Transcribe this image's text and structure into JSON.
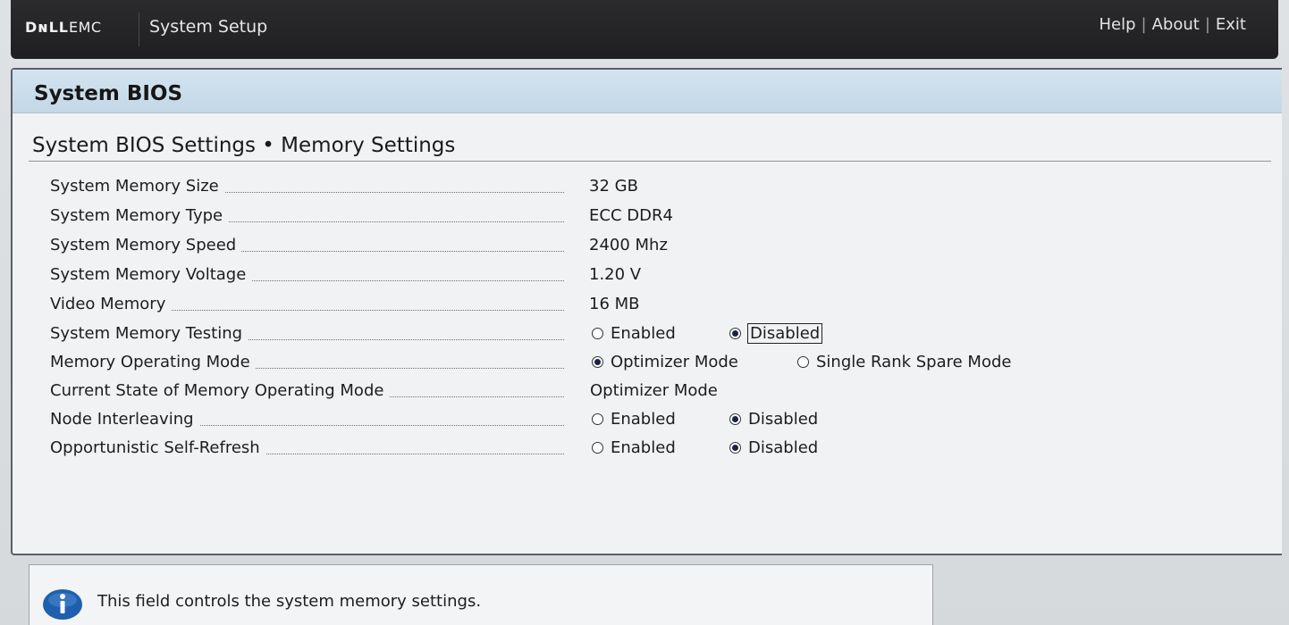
{
  "header": {
    "brand_dell": "DɴLL",
    "brand_emc": "EMC",
    "app_title": "System Setup",
    "links": [
      "Help",
      "About",
      "Exit"
    ],
    "separator": "|"
  },
  "panel": {
    "title": "System BIOS",
    "section_title": "System BIOS Settings • Memory Settings"
  },
  "rows": [
    {
      "label": "System Memory Size",
      "value": "32 GB"
    },
    {
      "label": "System Memory Type",
      "value": "ECC DDR4"
    },
    {
      "label": "System Memory Speed",
      "value": "2400 Mhz"
    },
    {
      "label": "System Memory Voltage",
      "value": "1.20 V"
    },
    {
      "label": "Video Memory",
      "value": "16 MB"
    },
    {
      "label": "System Memory Testing",
      "options": [
        "Enabled",
        "Disabled"
      ],
      "selected": "Disabled"
    },
    {
      "label": "Memory Operating Mode",
      "options": [
        "Optimizer Mode",
        "Single Rank Spare Mode"
      ],
      "selected": "Optimizer Mode"
    },
    {
      "label": "Current State of Memory Operating Mode",
      "value": "Optimizer Mode"
    },
    {
      "label": "Node Interleaving",
      "options": [
        "Enabled",
        "Disabled"
      ],
      "selected": "Disabled"
    },
    {
      "label": "Opportunistic Self-Refresh",
      "options": [
        "Enabled",
        "Disabled"
      ],
      "selected": "Disabled"
    }
  ],
  "help": {
    "text": "This field controls the system memory settings.",
    "icon": "info-icon"
  },
  "colors": {
    "header_bg": "#1f1f21",
    "panel_header_bg": "#c3d7e6",
    "info_icon": "#1f5fae"
  }
}
